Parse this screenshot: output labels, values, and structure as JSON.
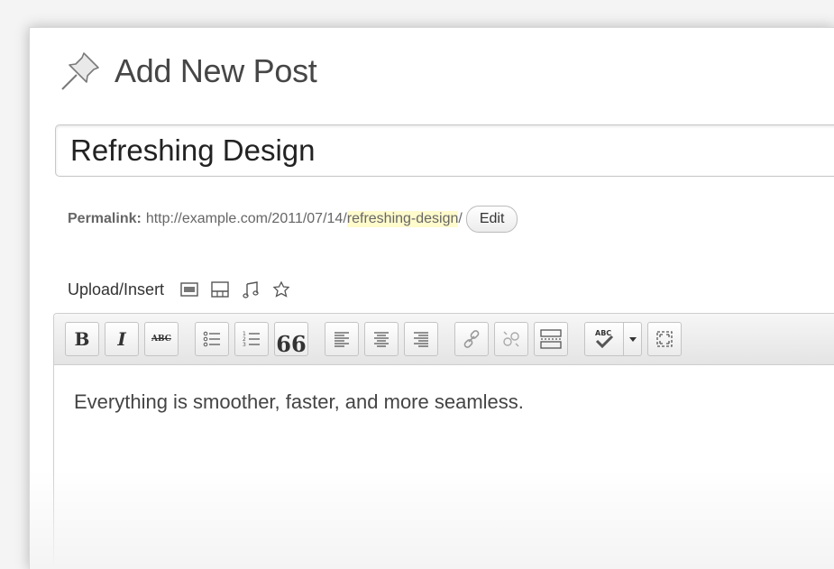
{
  "header": {
    "title": "Add New Post"
  },
  "post": {
    "title_value": "Refreshing Design",
    "permalink_label": "Permalink:",
    "permalink_base": "http://example.com/2011/07/14/",
    "permalink_slug": "refreshing-design",
    "permalink_sep": "/",
    "edit_label": "Edit"
  },
  "upload": {
    "label": "Upload/Insert",
    "icons": [
      "add-image-icon",
      "add-video-icon",
      "add-audio-icon",
      "add-media-icon"
    ]
  },
  "toolbar": {
    "bold_label": "B",
    "italic_label": "I",
    "strike_label": "ABC",
    "quote_label": "66",
    "spell_label": "ABC",
    "buttons": [
      "bold",
      "italic",
      "strikethrough",
      "bullet-list",
      "numbered-list",
      "blockquote",
      "align-left",
      "align-center",
      "align-right",
      "insert-link",
      "unlink",
      "insert-more",
      "spellcheck",
      "fullscreen"
    ]
  },
  "editor": {
    "content": "Everything is smoother, faster, and more seamless."
  }
}
